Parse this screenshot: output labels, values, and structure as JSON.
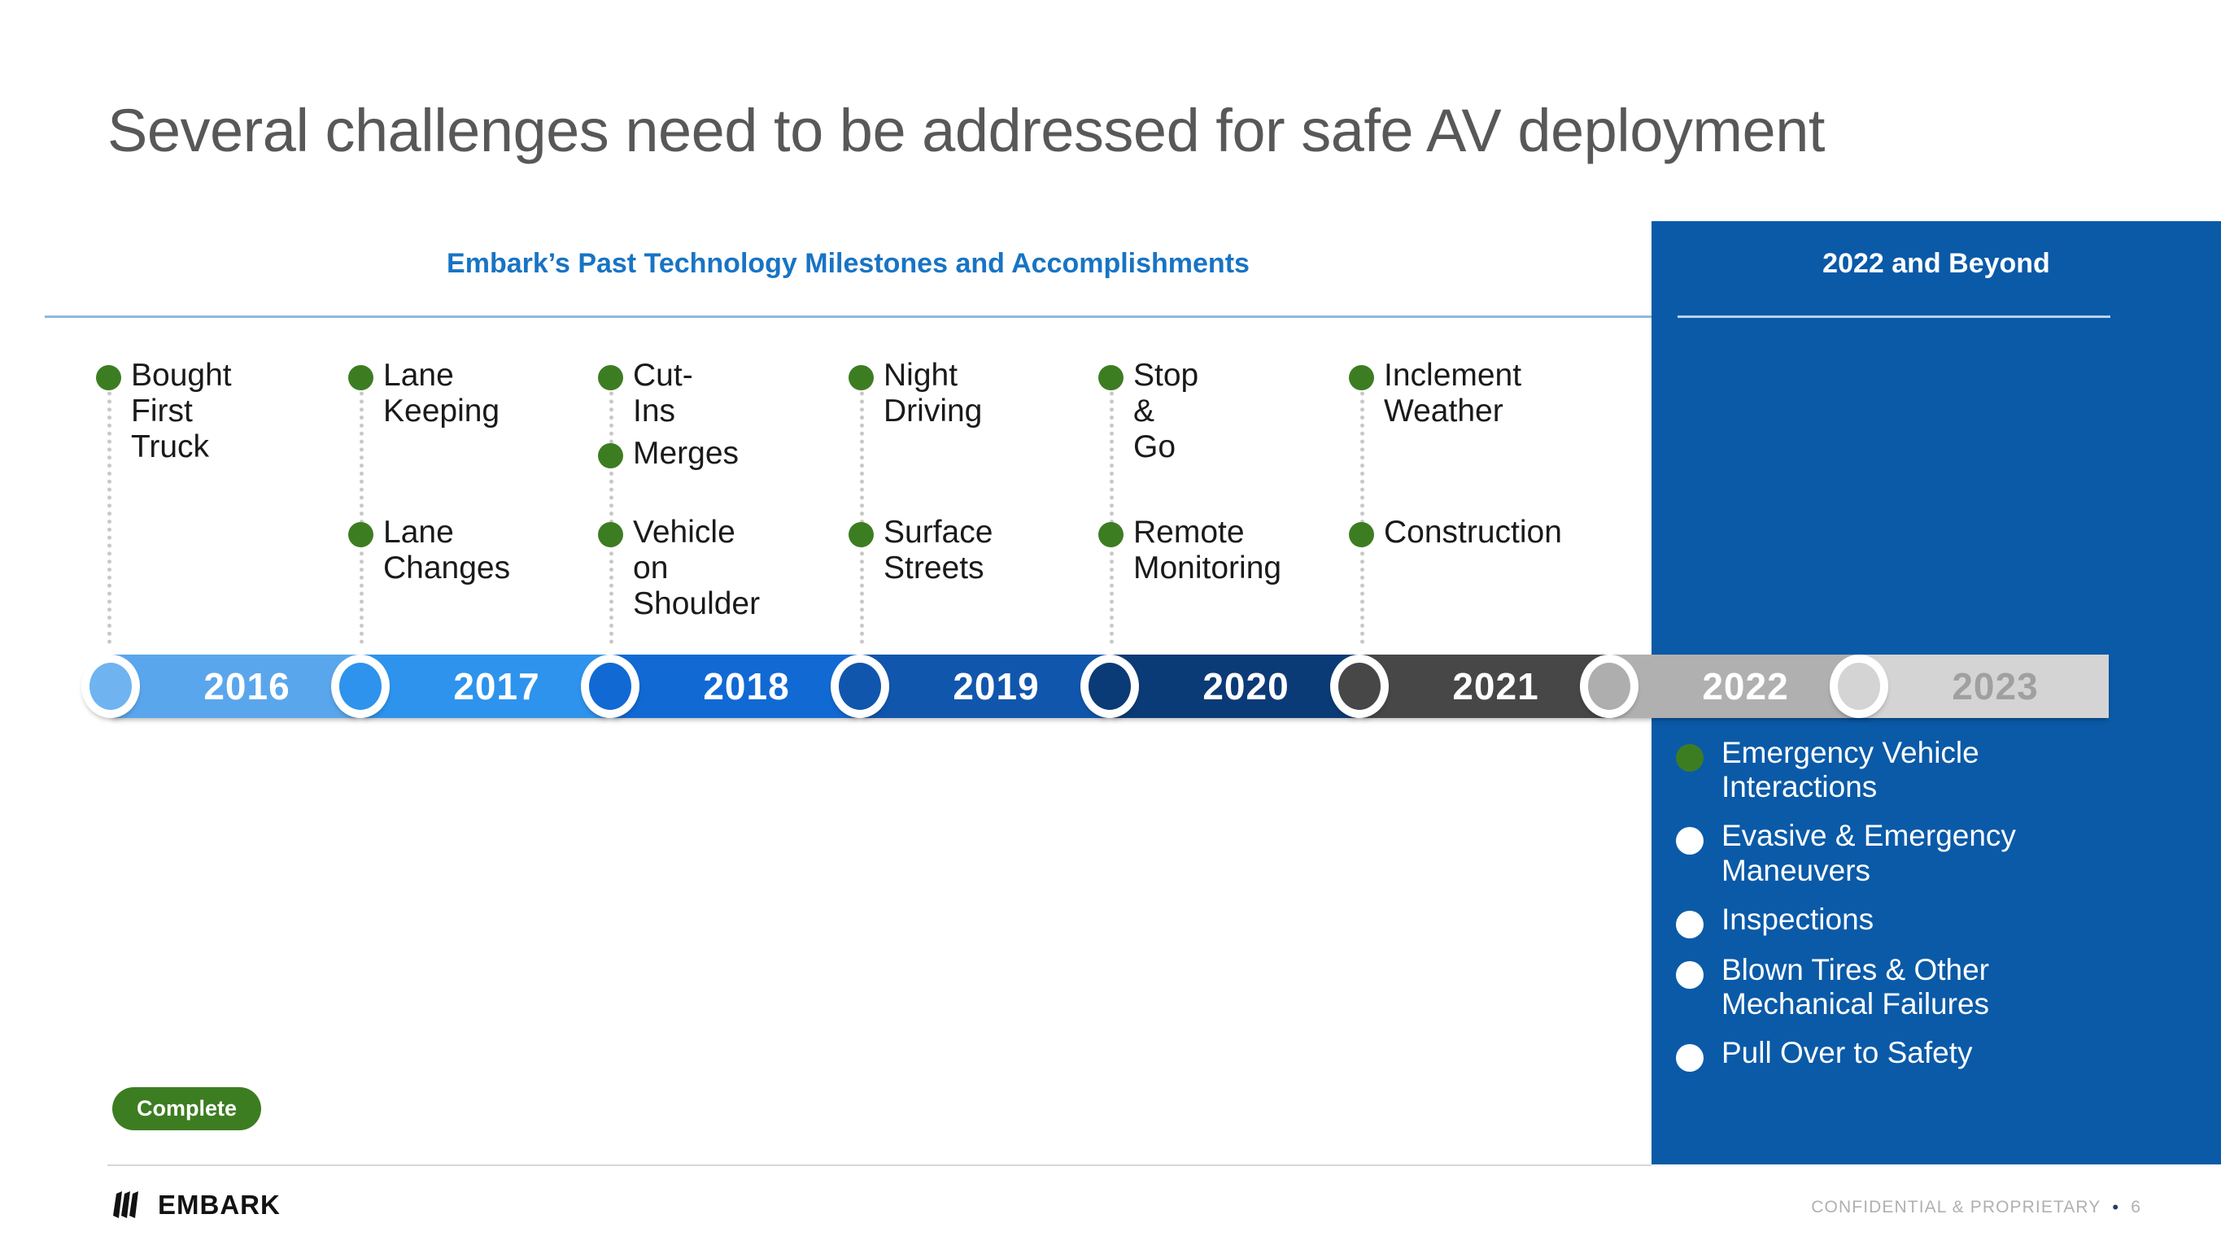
{
  "slide": {
    "title": "Several challenges need to be addressed for safe AV deployment",
    "left_heading": "Embark’s Past Technology Milestones and Accomplishments",
    "right_heading": "2022 and Beyond"
  },
  "colors": {
    "brand_blue": "#0a5aa8",
    "heading_blue": "#1874c4",
    "milestone_green": "#3d7d22",
    "title_gray": "#585858"
  },
  "timeline": {
    "years": [
      {
        "label": "2016",
        "bar_color": "#5aa6ec",
        "node_color": "#6fb4f0",
        "text_color": "#ffffff"
      },
      {
        "label": "2017",
        "bar_color": "#2d93ec",
        "node_color": "#2d93ec",
        "text_color": "#ffffff"
      },
      {
        "label": "2018",
        "bar_color": "#1169d4",
        "node_color": "#1169d4",
        "text_color": "#ffffff"
      },
      {
        "label": "2019",
        "bar_color": "#1156ad",
        "node_color": "#1156ad",
        "text_color": "#ffffff"
      },
      {
        "label": "2020",
        "bar_color": "#0b3b76",
        "node_color": "#0b3b76",
        "text_color": "#ffffff"
      },
      {
        "label": "2021",
        "bar_color": "#474747",
        "node_color": "#474747",
        "text_color": "#ffffff"
      },
      {
        "label": "2022",
        "bar_color": "#b0b0b0",
        "node_color": "#aeaeae",
        "text_color": "#ffffff"
      },
      {
        "label": "2023",
        "bar_color": "#d4d4d4",
        "node_color": "#d4d4d4",
        "text_color": "#a0a0a0"
      }
    ]
  },
  "milestone_columns": [
    {
      "year": "2016",
      "items": [
        {
          "label": "Bought First\nTruck",
          "row": 0
        }
      ]
    },
    {
      "year": "2017",
      "items": [
        {
          "label": "Lane Keeping",
          "row": 0
        },
        {
          "label": "Lane\nChanges",
          "row": 2
        }
      ]
    },
    {
      "year": "2018",
      "items": [
        {
          "label": "Cut-Ins",
          "row": 0
        },
        {
          "label": "Merges",
          "row": 1
        },
        {
          "label": "Vehicle on\nShoulder",
          "row": 2
        }
      ]
    },
    {
      "year": "2019",
      "items": [
        {
          "label": "Night Driving",
          "row": 0
        },
        {
          "label": "Surface\nStreets",
          "row": 2
        }
      ]
    },
    {
      "year": "2020",
      "items": [
        {
          "label": "Stop & Go",
          "row": 0
        },
        {
          "label": "Remote\nMonitoring",
          "row": 2
        }
      ]
    },
    {
      "year": "2021",
      "items": [
        {
          "label": "Inclement\nWeather",
          "row": 0
        },
        {
          "label": "Construction",
          "row": 2
        }
      ]
    }
  ],
  "future_items": [
    {
      "label": "Emergency Vehicle\nInteractions",
      "dot_color": "#3d7d22"
    },
    {
      "label": "Evasive & Emergency\nManeuvers",
      "dot_color": "#ffffff"
    },
    {
      "label": "Inspections",
      "dot_color": "#ffffff"
    },
    {
      "label": "Blown Tires & Other\nMechanical Failures",
      "dot_color": "#ffffff"
    },
    {
      "label": "Pull Over to Safety",
      "dot_color": "#ffffff"
    }
  ],
  "legend": {
    "complete_label": "Complete"
  },
  "footer": {
    "logo_text": "EMBARK",
    "confidential": "CONFIDENTIAL & PROPRIETARY",
    "separator": "•",
    "page_number": "6"
  }
}
